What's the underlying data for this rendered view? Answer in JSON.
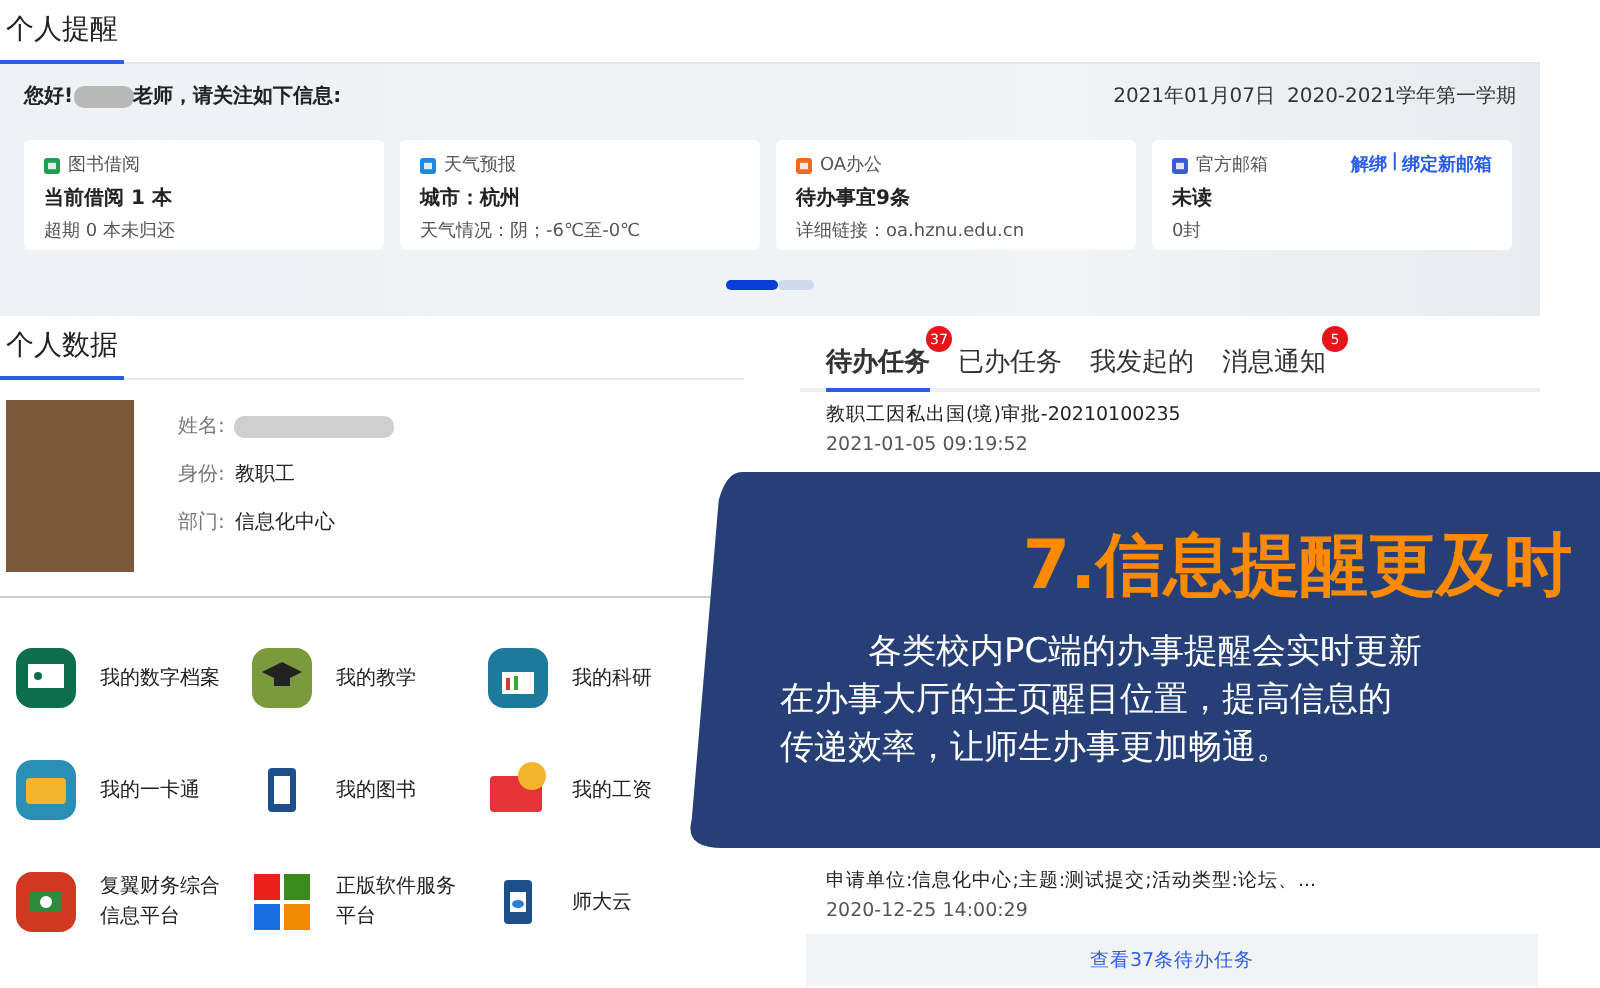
{
  "reminder": {
    "title": "个人提醒",
    "greeting_before": "您好!",
    "greeting_after": "老师，请关注如下信息:",
    "date": "2021年01月07日",
    "term": "2020-2021学年第一学期",
    "cards": [
      {
        "kind": "library",
        "label": "图书借阅",
        "main": "当前借阅 1 本",
        "detail": "超期 0 本未归还"
      },
      {
        "kind": "weather",
        "label": "天气预报",
        "main": "城市：杭州",
        "detail": "天气情况：阴；-6℃至-0℃"
      },
      {
        "kind": "office",
        "label": "OA办公",
        "main": "待办事宜9条",
        "detail": "详细链接：oa.hznu.edu.cn"
      },
      {
        "kind": "mail",
        "label": "官方邮箱",
        "main": "未读",
        "detail": "0封",
        "links": [
          "解绑",
          "绑定新邮箱"
        ],
        "link_separator": "|"
      }
    ],
    "pager": [
      {
        "selected": true
      },
      {
        "selected": false
      }
    ]
  },
  "profile": {
    "title": "个人数据",
    "fields": [
      {
        "label": "姓名:"
      },
      {
        "label": "身份:",
        "value": "教职工"
      },
      {
        "label": "部门:",
        "value": "信息化中心"
      }
    ]
  },
  "apps": [
    {
      "kind": "archive",
      "label": "我的数字档案"
    },
    {
      "kind": "teaching",
      "label": "我的教学"
    },
    {
      "kind": "research",
      "label": "我的科研"
    },
    {
      "kind": "card",
      "label": "我的一卡通"
    },
    {
      "kind": "book",
      "label": "我的图书"
    },
    {
      "kind": "salary",
      "label": "我的工资"
    },
    {
      "kind": "finance",
      "label": "复翼财务综合信息平台"
    },
    {
      "kind": "software",
      "label": "正版软件服务平台"
    },
    {
      "kind": "cloud",
      "label": "师大云"
    }
  ],
  "tasks": {
    "tabs": [
      {
        "label": "待办任务",
        "badge": "37",
        "selected": true
      },
      {
        "label": "已办任务",
        "selected": false
      },
      {
        "label": "我发起的",
        "selected": false
      },
      {
        "label": "消息通知",
        "badge": "5",
        "selected": false
      }
    ],
    "items": [
      {
        "title": "教职工因私出国(境)审批-20210100235",
        "time": "2021-01-05 09:19:52"
      },
      {
        "title": "申请单位:信息化中心;主题:测试提交;活动类型:论坛、...",
        "time": "2020-12-25 14:00:29"
      }
    ],
    "more": "查看37条待办任务"
  },
  "overlay": {
    "title": "7.信息提醒更及时",
    "lines": [
      "各类校内PC端的办事提醒会实时更新",
      "在办事大厅的主页醒目位置，提高信息的",
      "传递效率，让师生办事更加畅通。"
    ]
  }
}
